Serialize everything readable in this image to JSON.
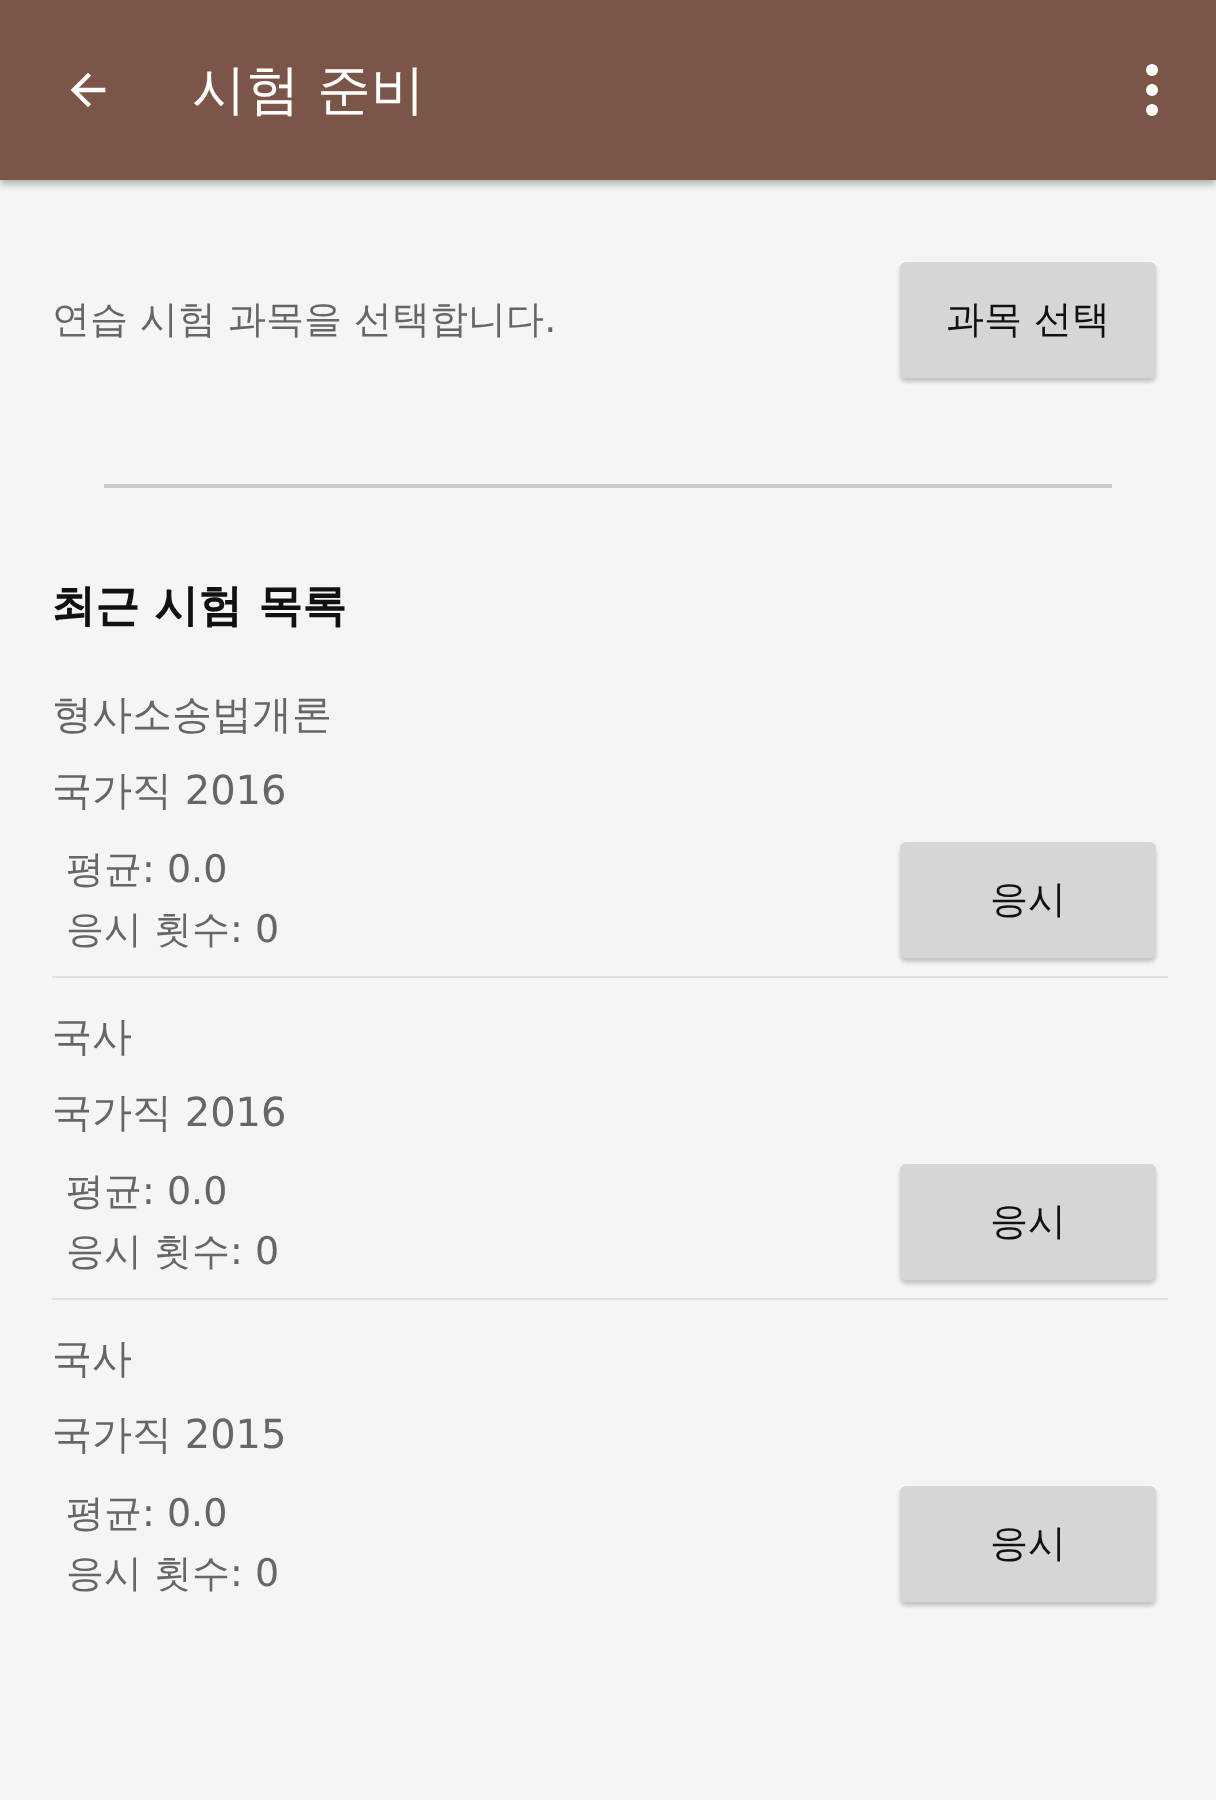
{
  "app_bar": {
    "title": "시험 준비"
  },
  "intro": {
    "text": "연습 시험 과목을 선택합니다.",
    "button": "과목 선택"
  },
  "recent": {
    "heading": "최근 시험 목록",
    "items": [
      {
        "subject": "형사소송법개론",
        "exam": "국가직 2016",
        "average": "평균: 0.0",
        "attempts": "응시 횟수: 0",
        "button": "응시"
      },
      {
        "subject": "국사",
        "exam": "국가직 2016",
        "average": "평균: 0.0",
        "attempts": "응시 횟수: 0",
        "button": "응시"
      },
      {
        "subject": "국사",
        "exam": "국가직 2015",
        "average": "평균: 0.0",
        "attempts": "응시 횟수: 0",
        "button": "응시"
      }
    ]
  }
}
